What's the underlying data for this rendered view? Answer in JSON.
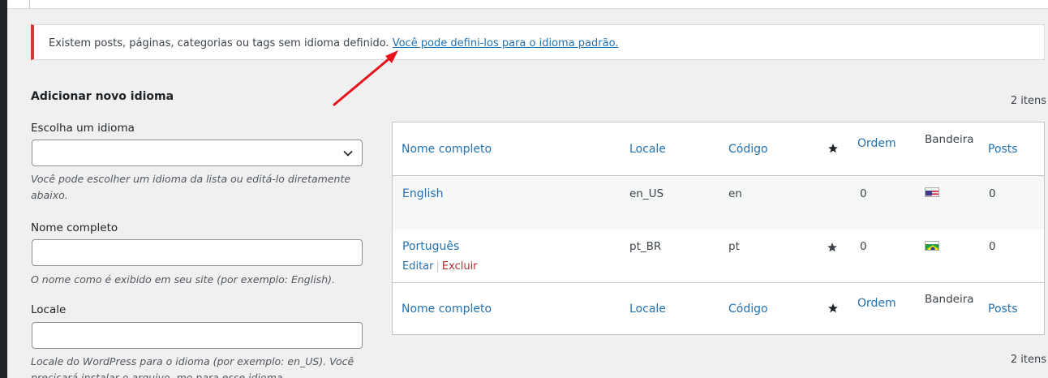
{
  "notice": {
    "text": "Existem posts, páginas, categorias ou tags sem idioma definido. ",
    "link": "Você pode defini-los para o idioma padrão."
  },
  "form": {
    "title": "Adicionar novo idioma",
    "choose_label": "Escolha um idioma",
    "choose_value": "",
    "choose_desc": "Você pode escolher um idioma da lista ou editá-lo diretamente abaixo.",
    "name_label": "Nome completo",
    "name_value": "",
    "name_desc": "O nome como é exibido em seu site (por exemplo: English).",
    "locale_label": "Locale",
    "locale_value": "",
    "locale_desc": "Locale do WordPress para o idioma (por exemplo: en_US). Você precisará instalar o arquivo .mo para esse idioma."
  },
  "table": {
    "count_top": "2 itens",
    "count_bottom": "2 itens",
    "columns": {
      "name": "Nome completo",
      "locale": "Locale",
      "code": "Código",
      "default_icon": "star-icon",
      "order": "Ordem",
      "flag": "Bandeira",
      "posts": "Posts"
    },
    "rows": [
      {
        "name": "English",
        "locale": "en_US",
        "code": "en",
        "is_default": false,
        "order": "0",
        "flag": "us-flag",
        "posts": "0"
      },
      {
        "name": "Português",
        "locale": "pt_BR",
        "code": "pt",
        "is_default": true,
        "order": "0",
        "flag": "br-flag",
        "posts": "0"
      }
    ],
    "row_actions": {
      "edit": "Editar",
      "delete": "Excluir"
    }
  },
  "colors": {
    "link": "#2271b1",
    "notice_error": "#d63638",
    "delete": "#b32d2e",
    "arrow": "#e8121a"
  }
}
